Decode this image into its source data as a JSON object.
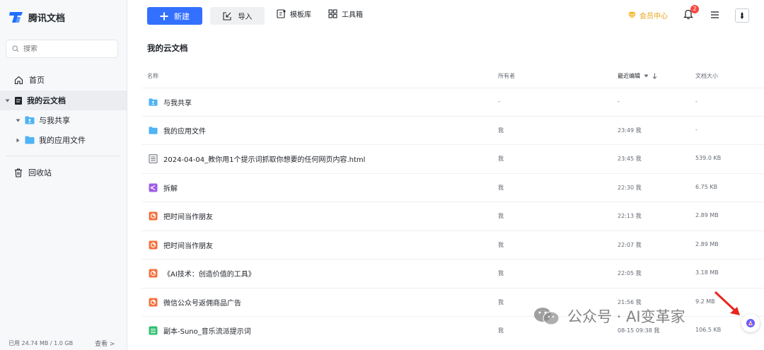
{
  "app": {
    "name": "腾讯文档"
  },
  "sidebar": {
    "search_placeholder": "搜索",
    "items": [
      {
        "label": "首页",
        "icon": "home-icon"
      },
      {
        "label": "我的云文档",
        "icon": "doc-folder-icon"
      },
      {
        "label": "与我共享",
        "icon": "shared-folder-icon"
      },
      {
        "label": "我的应用文件",
        "icon": "folder-icon"
      },
      {
        "label": "回收站",
        "icon": "trash-icon"
      }
    ],
    "storage": "已用 24.74 MB / 1.0 GB",
    "storage_link": "查看 >"
  },
  "toolbar": {
    "new_label": "新建",
    "import_label": "导入",
    "template_label": "模板库",
    "toolbox_label": "工具箱",
    "vip_label": "会员中心",
    "notification_count": "2"
  },
  "main": {
    "title": "我的云文档",
    "columns": {
      "name": "名称",
      "owner": "所有者",
      "modified": "最近编辑",
      "size": "文档大小"
    },
    "rows": [
      {
        "name": "与我共享",
        "type": "shared-folder",
        "owner": "-",
        "modified": "-",
        "size": "-"
      },
      {
        "name": "我的应用文件",
        "type": "folder",
        "owner": "我",
        "modified": "23:49 我",
        "size": "-"
      },
      {
        "name": "2024-04-04_教你用1个提示词抓取你想要的任何网页内容.html",
        "type": "file",
        "owner": "我",
        "modified": "23:45 我",
        "size": "539.0 KB"
      },
      {
        "name": "拆解",
        "type": "mindmap",
        "owner": "我",
        "modified": "22:30 我",
        "size": "6.75 KB"
      },
      {
        "name": "把时间当作朋友",
        "type": "slides",
        "owner": "我",
        "modified": "22:13 我",
        "size": "2.89 MB"
      },
      {
        "name": "把时间当作朋友",
        "type": "slides",
        "owner": "我",
        "modified": "22:07 我",
        "size": "2.89 MB"
      },
      {
        "name": "《AI技术：创造价值的工具》",
        "type": "slides",
        "owner": "我",
        "modified": "22:05 我",
        "size": "3.18 MB"
      },
      {
        "name": "微信公众号返佣商品广告",
        "type": "slides",
        "owner": "我",
        "modified": "21:56 我",
        "size": "9.2 MB"
      },
      {
        "name": "副本-Suno_音乐流派提示词",
        "type": "sheet",
        "owner": "我",
        "modified": "08-15 09:38 我",
        "size": "106.5 KB"
      }
    ]
  },
  "watermark": {
    "text": "公众号 · AI变革家"
  },
  "colors": {
    "accent": "#3370ff",
    "vip": "#e8a317",
    "badge": "#f54a45",
    "folder": "#4fb3f6",
    "mindmap": "#9e5fe8",
    "slides": "#f5713b",
    "sheet": "#2ec06d"
  }
}
